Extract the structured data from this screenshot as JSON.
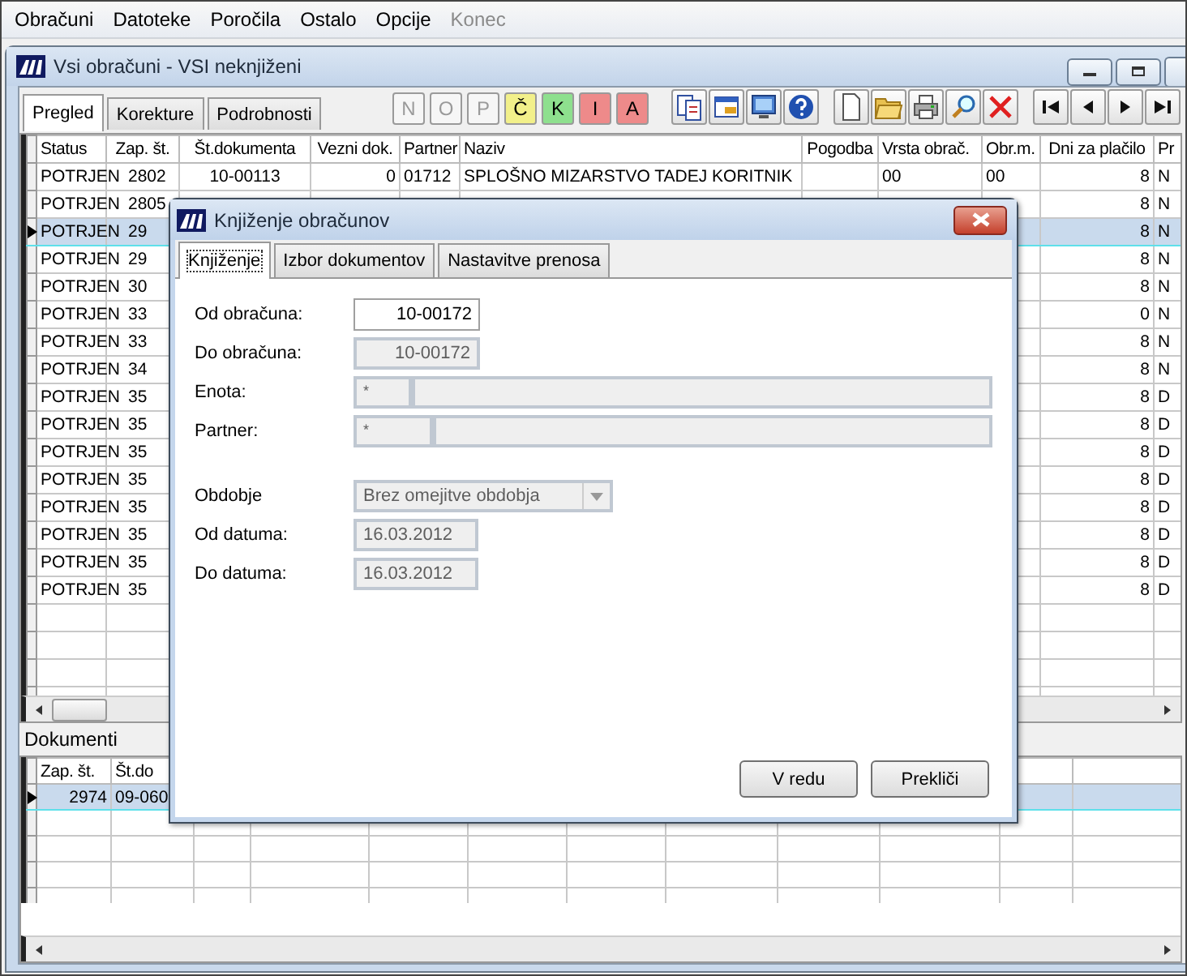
{
  "menu": [
    {
      "label": "Obračuni",
      "disabled": false
    },
    {
      "label": "Datoteke",
      "disabled": false
    },
    {
      "label": "Poročila",
      "disabled": false
    },
    {
      "label": "Ostalo",
      "disabled": false
    },
    {
      "label": "Opcije",
      "disabled": false
    },
    {
      "label": "Konec",
      "disabled": true
    }
  ],
  "window": {
    "title": "Vsi obračuni - VSI neknjiženi"
  },
  "tabs": [
    {
      "label": "Pregled",
      "selected": true
    },
    {
      "label": "Korekture",
      "selected": false
    },
    {
      "label": "Podrobnosti",
      "selected": false
    }
  ],
  "letter_buttons": [
    {
      "label": "N",
      "disabled": true,
      "color": "#f6f6f6"
    },
    {
      "label": "O",
      "disabled": true,
      "color": "#f6f6f6"
    },
    {
      "label": "P",
      "disabled": true,
      "color": "#f6f6f6"
    },
    {
      "label": "Č",
      "disabled": false,
      "color": "#f2f08a"
    },
    {
      "label": "K",
      "disabled": false,
      "color": "#8ee08e"
    },
    {
      "label": "I",
      "disabled": false,
      "color": "#ee8a8a"
    },
    {
      "label": "A",
      "disabled": false,
      "color": "#ee8a8a"
    }
  ],
  "icon_buttons": [
    {
      "kind": "reports"
    },
    {
      "kind": "window"
    },
    {
      "kind": "screen"
    },
    {
      "kind": "help"
    },
    {
      "kind": "new"
    },
    {
      "kind": "open"
    },
    {
      "kind": "print"
    },
    {
      "kind": "find"
    },
    {
      "kind": "delete"
    },
    {
      "kind": "first"
    },
    {
      "kind": "prev"
    },
    {
      "kind": "next"
    },
    {
      "kind": "last"
    }
  ],
  "table": {
    "columns": [
      "Status",
      "Zap. št.",
      "Št.dokumenta",
      "Vezni dok.",
      "Partner",
      "Naziv",
      "Pogodba",
      "Vrsta obrač.",
      "Obr.m.",
      "Dni za plačilo",
      "Pr"
    ],
    "rows": [
      {
        "selected": false,
        "cells": [
          "POTRJEN",
          "2802",
          "10-00113",
          "0",
          "01712",
          "SPLOŠNO MIZARSTVO TADEJ KORITNIK",
          null,
          "00",
          "00",
          "8",
          "N"
        ]
      },
      {
        "selected": false,
        "cells": [
          "POTRJEN",
          "2805",
          null,
          null,
          null,
          null,
          null,
          null,
          null,
          "8",
          "N"
        ]
      },
      {
        "selected": true,
        "cells": [
          "POTRJEN",
          "29",
          null,
          null,
          null,
          null,
          null,
          null,
          null,
          "8",
          "N"
        ]
      },
      {
        "selected": false,
        "cells": [
          "POTRJEN",
          "29",
          null,
          null,
          null,
          null,
          null,
          null,
          null,
          "8",
          "N"
        ]
      },
      {
        "selected": false,
        "cells": [
          "POTRJEN",
          "30",
          null,
          null,
          null,
          null,
          null,
          null,
          null,
          "8",
          "N"
        ]
      },
      {
        "selected": false,
        "cells": [
          "POTRJEN",
          "33",
          null,
          null,
          null,
          null,
          null,
          null,
          null,
          "0",
          "N"
        ]
      },
      {
        "selected": false,
        "cells": [
          "POTRJEN",
          "33",
          null,
          null,
          null,
          null,
          null,
          null,
          null,
          "8",
          "N"
        ]
      },
      {
        "selected": false,
        "cells": [
          "POTRJEN",
          "34",
          null,
          null,
          null,
          null,
          null,
          null,
          null,
          "8",
          "N"
        ]
      },
      {
        "selected": false,
        "cells": [
          "POTRJEN",
          "35",
          null,
          null,
          null,
          null,
          null,
          null,
          null,
          "8",
          "D"
        ]
      },
      {
        "selected": false,
        "cells": [
          "POTRJEN",
          "35",
          null,
          null,
          null,
          null,
          null,
          null,
          null,
          "8",
          "D"
        ]
      },
      {
        "selected": false,
        "cells": [
          "POTRJEN",
          "35",
          null,
          null,
          null,
          null,
          null,
          null,
          null,
          "8",
          "D"
        ]
      },
      {
        "selected": false,
        "cells": [
          "POTRJEN",
          "35",
          null,
          null,
          null,
          null,
          null,
          null,
          null,
          "8",
          "D"
        ]
      },
      {
        "selected": false,
        "cells": [
          "POTRJEN",
          "35",
          null,
          null,
          null,
          null,
          null,
          null,
          null,
          "8",
          "D"
        ]
      },
      {
        "selected": false,
        "cells": [
          "POTRJEN",
          "35",
          null,
          null,
          null,
          null,
          null,
          null,
          null,
          "8",
          "D"
        ]
      },
      {
        "selected": false,
        "cells": [
          "POTRJEN",
          "35",
          null,
          null,
          null,
          null,
          null,
          null,
          null,
          "8",
          "D"
        ]
      },
      {
        "selected": false,
        "cells": [
          "POTRJEN",
          "35",
          null,
          null,
          null,
          null,
          null,
          null,
          null,
          "8",
          "D"
        ]
      }
    ]
  },
  "documents": {
    "title": "Dokumenti",
    "columns": [
      "Zap. št.",
      "Št.do"
    ],
    "rows": [
      {
        "selected": true,
        "cells": [
          "2974",
          "09-060"
        ]
      }
    ]
  },
  "dialog": {
    "title": "Knjiženje obračunov",
    "tabs": [
      {
        "label": "Knjiženje",
        "selected": true
      },
      {
        "label": "Izbor dokumentov",
        "selected": false
      },
      {
        "label": "Nastavitve prenosa",
        "selected": false
      }
    ],
    "fields": [
      {
        "label": "Od obračuna:",
        "kind": "number",
        "value": "10-00172",
        "disabled": false
      },
      {
        "label": "Do obračuna:",
        "kind": "number",
        "value": "10-00172",
        "disabled": true
      },
      {
        "label": "Enota:",
        "kind": "lookup",
        "value": "*",
        "disabled": true
      },
      {
        "label": "Partner:",
        "kind": "lookup",
        "value": "*",
        "disabled": true
      }
    ],
    "period_fields": [
      {
        "label": "Obdobje",
        "kind": "dropdown",
        "value": "Brez omejitve obdobja",
        "disabled": true
      },
      {
        "label": "Od datuma:",
        "kind": "date",
        "value": "16.03.2012",
        "disabled": true
      },
      {
        "label": "Do datuma:",
        "kind": "date",
        "value": "16.03.2012",
        "disabled": true
      }
    ],
    "buttons": [
      "V redu",
      "Prekliči"
    ]
  }
}
